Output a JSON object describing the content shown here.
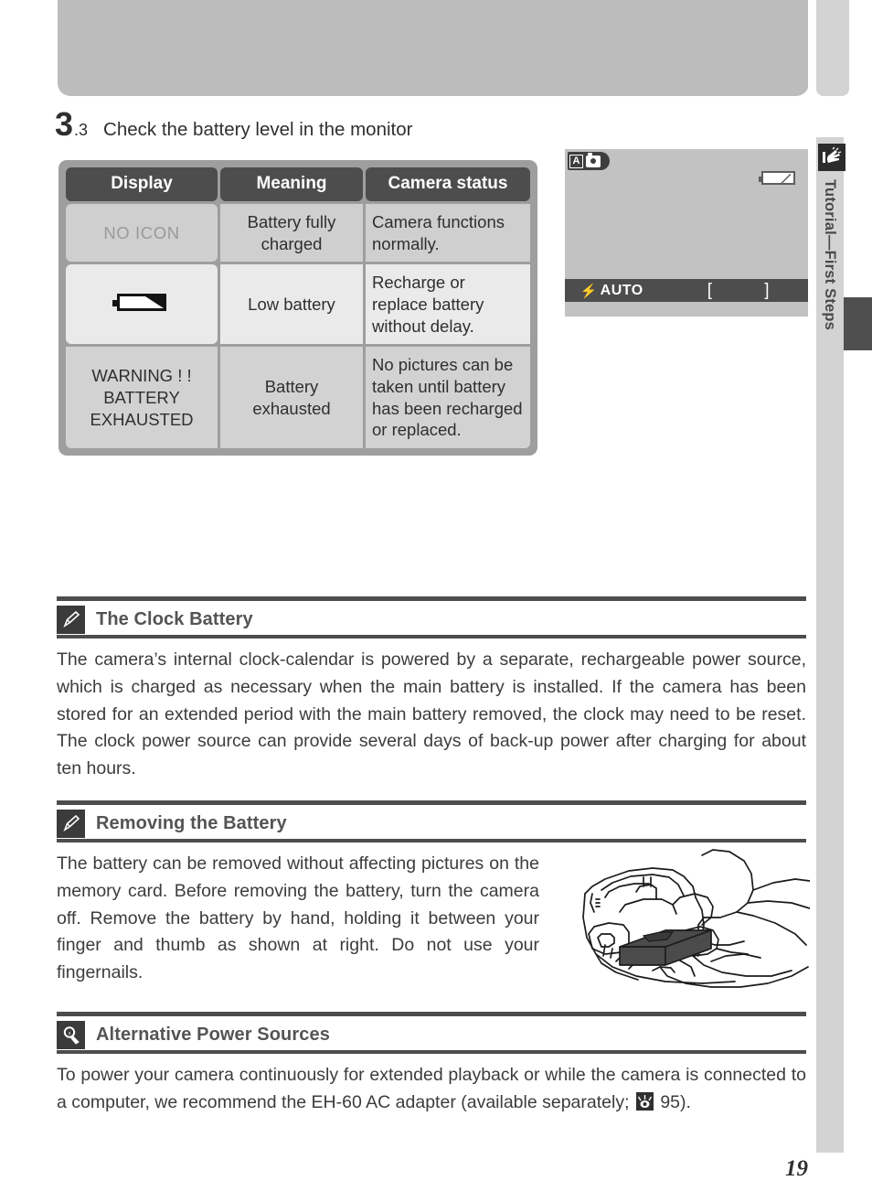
{
  "page": {
    "number": "19",
    "rail_label": "Tutorial—First Steps"
  },
  "step": {
    "number": "3",
    "sub": ".3",
    "title": "Check the battery level in the monitor"
  },
  "table": {
    "headers": [
      "Display",
      "Meaning",
      "Camera status"
    ],
    "rows": [
      {
        "display": "NO ICON",
        "display_kind": "text",
        "meaning": "Battery fully charged",
        "status": "Camera functions normally."
      },
      {
        "display": "",
        "display_kind": "low-battery-icon",
        "meaning": "Low battery",
        "status": "Recharge or replace battery without delay."
      },
      {
        "display": "WARNING ! ! BATTERY EXHAUSTED",
        "display_kind": "text",
        "meaning": "Battery exhausted",
        "status": "No pictures can be taken until battery has been recharged or replaced."
      }
    ]
  },
  "monitor": {
    "mode_letter": "A",
    "flash_label": "AUTO",
    "bolt": "⚡",
    "brackets": "[ ]"
  },
  "notes": [
    {
      "icon": "pencil-icon",
      "title": "The Clock Battery",
      "body": "The camera’s internal clock-calendar is powered by a separate, rechargeable power source, which is charged as necessary when the main battery is installed.  If the camera has been stored for an extended period with the main battery removed, the clock may need to be reset.  The clock power source can provide several days of back-up power after charging for about ten hours."
    },
    {
      "icon": "pencil-icon",
      "title": "Removing the Battery",
      "body": "The battery can be removed without affecting pictures on the memory card.  Before removing the battery, turn the camera off.  Remove the battery by hand, holding it between your finger and thumb as shown at right.  Do not use your fingernails."
    },
    {
      "icon": "magnifier-icon",
      "title": "Alternative Power Sources",
      "body_pre": "To power your camera continuously for extended playback or while the camera is connected to a computer, we recommend the EH-60 AC adapter (available separately; ",
      "body_post": " 95)."
    }
  ],
  "colors": {
    "header_bar": "#4d4d4d",
    "table_frame": "#9e9e9e",
    "rail": "#d3d3d3",
    "top_band": "#bcbcbc"
  }
}
